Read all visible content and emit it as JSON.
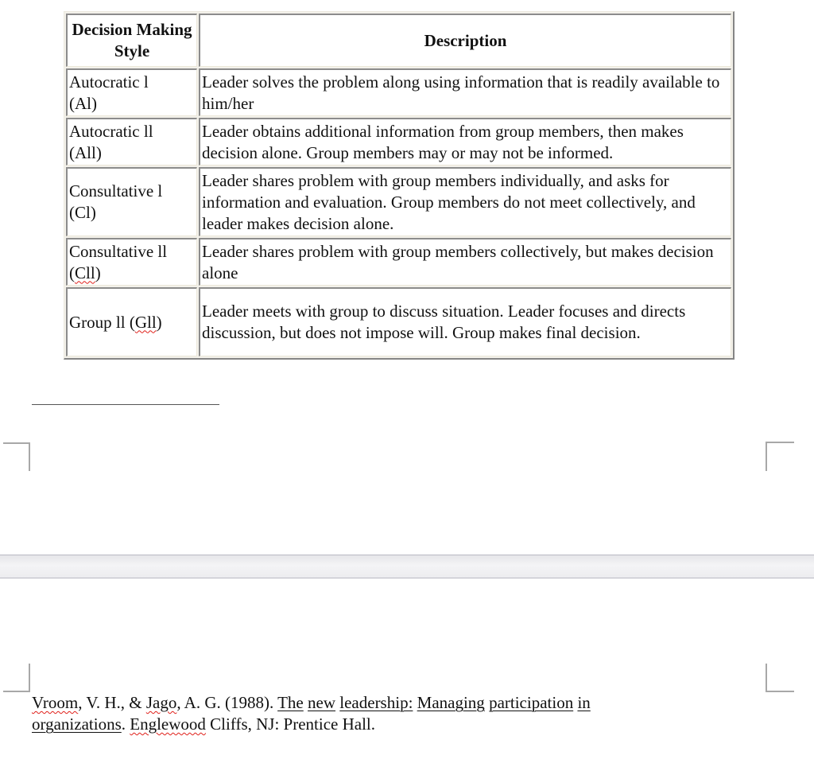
{
  "table": {
    "headers": {
      "style": "Decision Making Style",
      "description": "Description"
    },
    "rows": [
      {
        "style_name": "Autocratic l",
        "style_code": "(Al)",
        "description": "Leader solves the problem along using information that is readily available to him/her"
      },
      {
        "style_name": "Autocratic ll",
        "style_code": "(All)",
        "description": "Leader obtains additional information from group members, then makes decision alone. Group members may or may not be informed."
      },
      {
        "style_name": "Consultative l",
        "style_code": "(Cl)",
        "description": "Leader shares problem with group members individually, and asks for information and evaluation. Group members do not meet collectively, and leader makes decision alone."
      },
      {
        "style_name": "Consultative ll",
        "style_code_open": "(",
        "style_code_flagged": "Cll",
        "style_code_close": ")",
        "description": "Leader shares problem with group members collectively, but makes decision alone"
      },
      {
        "style_name": "Group ll",
        "style_code_open": "(",
        "style_code_flagged": "Gll",
        "style_code_close": ")",
        "description": "Leader meets with group to discuss situation. Leader focuses and directs discussion, but does not impose will. Group makes final decision."
      }
    ]
  },
  "reference": {
    "author1": "Vroom",
    "author1_rest": ", V. H., & ",
    "author2": "Jago",
    "author2_rest": ", A. G. (1988). ",
    "title_words": [
      "The",
      "new",
      "leadership:",
      "Managing",
      "participation",
      "in",
      "organizations"
    ],
    "after_title": ". ",
    "place_flagged": "Englewood",
    "place_rest": " Cliffs, NJ: Prentice Hall."
  },
  "colors": {
    "spellcheck_underline": "#e0201a",
    "page_gap": "#f0f0f2",
    "corner_marks": "#a8a8a8"
  }
}
